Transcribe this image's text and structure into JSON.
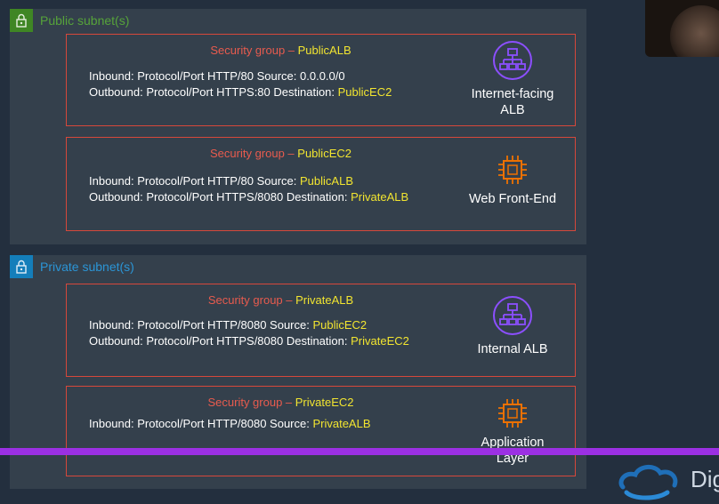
{
  "public_subnet": {
    "title": "Public subnet(s)",
    "groups": [
      {
        "title_prefix": "Security group – ",
        "name": "PublicALB",
        "inbound": "Inbound: Protocol/Port HTTP/80 Source: 0.0.0.0/0",
        "outbound_text": "Outbound: Protocol/Port HTTPS:80 Destination: ",
        "outbound_target": "PublicEC2",
        "service_icon": "load-balancer-icon",
        "service_line1": "Internet-facing",
        "service_line2": "ALB"
      },
      {
        "title_prefix": "Security group – ",
        "name": "PublicEC2",
        "inbound_text": "Inbound: Protocol/Port HTTP/80 Source: ",
        "inbound_source": "PublicALB",
        "outbound_text": "Outbound: Protocol/Port HTTPS/8080 Destination: ",
        "outbound_target": "PrivateALB",
        "service_icon": "ec2-chip-icon",
        "service_line1": "Web Front-End"
      }
    ]
  },
  "private_subnet": {
    "title": "Private subnet(s)",
    "groups": [
      {
        "title_prefix": "Security group – ",
        "name": "PrivateALB",
        "inbound_text": "Inbound: Protocol/Port HTTP/8080 Source: ",
        "inbound_source": "PublicEC2",
        "outbound_text": "Outbound: Protocol/Port HTTPS/8080 Destination: ",
        "outbound_target": "PrivateEC2",
        "service_icon": "load-balancer-icon",
        "service_line1": "Internal ALB"
      },
      {
        "title_prefix": "Security group – ",
        "name": "PrivateEC2",
        "inbound_text": "Inbound: Protocol/Port HTTP/8080 Source: ",
        "inbound_source": "PrivateALB",
        "service_icon": "ec2-chip-icon",
        "service_line1": "Application",
        "service_line2": "Layer"
      }
    ]
  },
  "colors": {
    "background": "#232f3e",
    "subnet_panel": "#34404c",
    "public_accent": "#3f8624",
    "private_accent": "#147eba",
    "sg_border": "#d6483b",
    "highlight": "#f2e530",
    "alb_icon": "#8c4fff",
    "ec2_icon": "#ed7100",
    "overlay_bar": "#9b30e3"
  },
  "overlay": {
    "logo_text": "Dig"
  }
}
